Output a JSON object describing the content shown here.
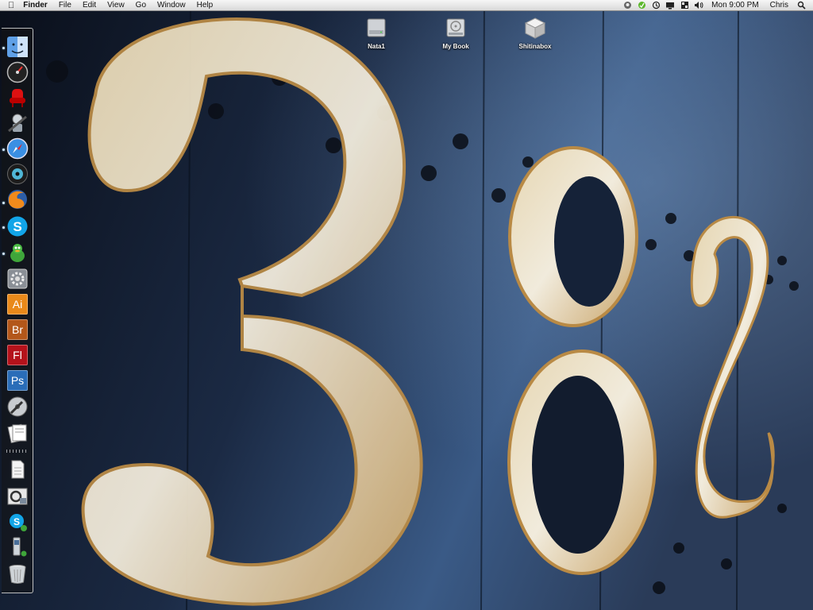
{
  "menubar": {
    "apple_glyph": "",
    "app_name": "Finder",
    "menus": [
      "File",
      "Edit",
      "View",
      "Go",
      "Window",
      "Help"
    ],
    "clock": "Mon 9:00 PM",
    "user": "Chris",
    "status_icons": [
      "skype-status-icon",
      "adium-status-icon",
      "time-machine-icon",
      "display-icon",
      "spaces-icon",
      "volume-icon",
      "spotlight-icon"
    ]
  },
  "desktop": {
    "icons": [
      {
        "label": "Nata1",
        "icon": "hard-drive-icon"
      },
      {
        "label": "My Book",
        "icon": "external-drive-icon"
      },
      {
        "label": "Shitinabox",
        "icon": "box-icon"
      }
    ]
  },
  "dock": {
    "items": [
      {
        "name": "finder",
        "running": true
      },
      {
        "name": "dashboard",
        "running": false
      },
      {
        "name": "front-row",
        "running": false
      },
      {
        "name": "automator",
        "running": false
      },
      {
        "name": "safari",
        "running": true
      },
      {
        "name": "dvd-player",
        "running": false
      },
      {
        "name": "firefox",
        "running": true
      },
      {
        "name": "skype",
        "running": true
      },
      {
        "name": "adium",
        "running": true
      },
      {
        "name": "system-preferences",
        "running": false
      },
      {
        "name": "illustrator",
        "label": "Ai",
        "running": false
      },
      {
        "name": "bridge",
        "label": "Br",
        "running": false
      },
      {
        "name": "flash",
        "label": "Fl",
        "running": false
      },
      {
        "name": "photoshop",
        "label": "Ps",
        "running": false
      },
      {
        "name": "disk-utility",
        "running": false
      },
      {
        "name": "preview",
        "running": false
      },
      {
        "name": "documents-stack",
        "running": false
      },
      {
        "name": "downloads-stack",
        "running": false
      },
      {
        "name": "skype-stack",
        "running": false
      },
      {
        "name": "applications-stack",
        "running": false
      },
      {
        "name": "trash",
        "running": false
      }
    ]
  },
  "colors": {
    "wallpaper_base": "#0d1320",
    "wallpaper_blue": "#3d5e8c",
    "numeral_cream": "#efe7d3",
    "numeral_rust": "#c08a3a",
    "menubar": "#e8e8e8"
  }
}
